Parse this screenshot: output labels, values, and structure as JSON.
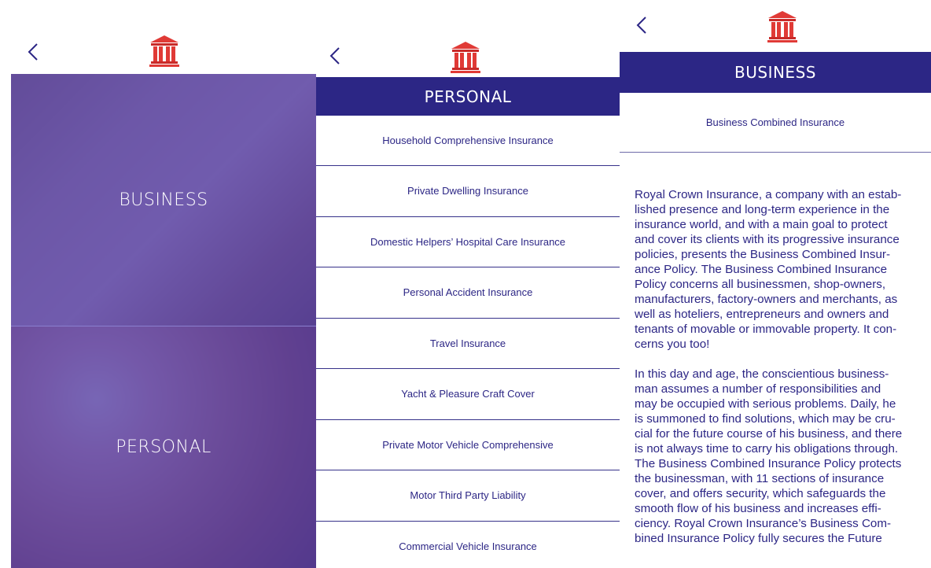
{
  "colors": {
    "brand_purple": "#2c2685",
    "overlay_purple": "#422e9e",
    "logo_red": "#e03030",
    "background": "#ffffff"
  },
  "icons": {
    "back": "chevron-left-icon",
    "logo": "bank-building-icon"
  },
  "panel_home": {
    "tiles": [
      {
        "label": "BUSINESS"
      },
      {
        "label": "PERSONAL"
      }
    ]
  },
  "panel_personal": {
    "title": "PERSONAL",
    "items": [
      "Household Comprehensive Insurance",
      "Private Dwelling Insurance",
      "Domestic Helpers’ Hospital Care Insurance",
      "Personal Accident Insurance",
      "Travel Insurance",
      "Yacht & Pleasure Craft Cover",
      "Private Motor Vehicle Comprehensive",
      "Motor Third Party Liability",
      "Commercial Vehicle Insurance"
    ]
  },
  "panel_business": {
    "title": "BUSINESS",
    "subtitle": "Business Combined Insurance",
    "paragraph_1_lines": [
      "Royal Crown Insurance, a company with an estab-",
      "lished presence and long-term experience in the",
      "insurance world, and with a main goal to protect",
      "and cover its clients with its progressive insurance",
      "policies, presents the Business Combined Insur-",
      "ance Policy. The Business Combined Insurance",
      "Policy concerns all businessmen, shop-owners,",
      "manufacturers, factory-owners and merchants, as",
      "well as hoteliers, entrepreneurs and owners and",
      "tenants of movable or immovable property. It con-",
      "cerns you too!"
    ],
    "paragraph_2_lines": [
      "In this day and age, the conscientious business-",
      "man assumes a number of responsibilities and",
      "may be occupied with serious problems. Daily, he",
      "is summoned to find solutions, which may be cru-",
      "cial for the future course of his business, and there",
      "is not always time to carry his obligations through.",
      "The Business Combined Insurance Policy protects",
      "the businessman, with 11 sections of insurance",
      "cover, and offers security, which safeguards the",
      "smooth flow of his business and increases effi-",
      "ciency. Royal Crown Insurance’s Business Com-",
      "bined Insurance Policy fully secures the Future"
    ]
  }
}
